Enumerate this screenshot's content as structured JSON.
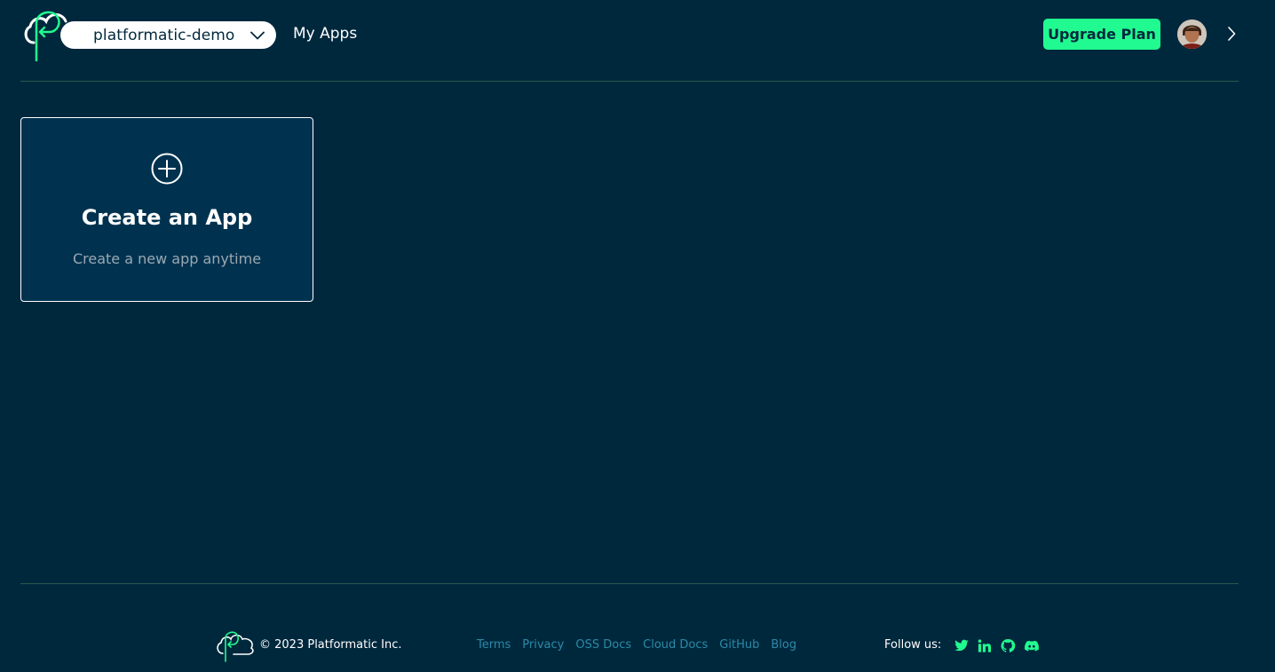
{
  "header": {
    "org_selector": {
      "value": "platformatic-demo"
    },
    "nav": {
      "my_apps": "My Apps"
    },
    "upgrade_label": "Upgrade Plan",
    "icons": {
      "logo": "platformatic-cloud-logo",
      "org_chevron": "chevron-down-icon",
      "profile_chevron": "chevron-right-icon",
      "avatar": "user-avatar"
    }
  },
  "main": {
    "create_card": {
      "title": "Create an App",
      "subtitle": "Create a new app anytime",
      "icon": "plus-circle-icon"
    }
  },
  "footer": {
    "copyright": "© 2023 Platformatic Inc.",
    "links": [
      "Terms",
      "Privacy",
      "OSS Docs",
      "Cloud Docs",
      "GitHub",
      "Blog"
    ],
    "follow_label": "Follow us:",
    "social_icons": [
      "twitter-icon",
      "linkedin-icon",
      "github-icon",
      "discord-icon"
    ]
  },
  "colors": {
    "background": "#00283d",
    "card_background": "#00324f",
    "accent": "#21fa90",
    "link": "#2c8aa8",
    "divider": "#2a5a4b"
  }
}
